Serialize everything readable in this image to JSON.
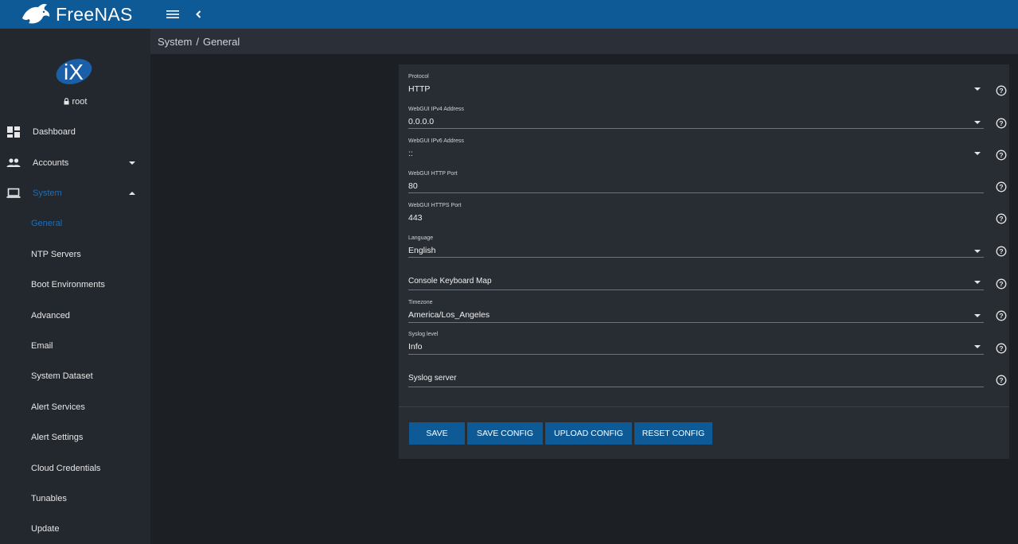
{
  "app": {
    "brand": "FreeNAS",
    "tm": "™"
  },
  "header": {
    "menu_icon": "hamburger-icon",
    "back_icon": "chevron-left-icon"
  },
  "sidebar": {
    "user": "root",
    "items": [
      {
        "label": "Dashboard",
        "icon": "dashboard-icon"
      },
      {
        "label": "Accounts",
        "icon": "people-icon"
      },
      {
        "label": "System",
        "icon": "laptop-icon"
      }
    ],
    "sub_items": [
      {
        "label": "General"
      },
      {
        "label": "NTP Servers"
      },
      {
        "label": "Boot Environments"
      },
      {
        "label": "Advanced"
      },
      {
        "label": "Email"
      },
      {
        "label": "System Dataset"
      },
      {
        "label": "Alert Services"
      },
      {
        "label": "Alert Settings"
      },
      {
        "label": "Cloud Credentials"
      },
      {
        "label": "Tunables"
      },
      {
        "label": "Update"
      }
    ]
  },
  "breadcrumb": {
    "parent": "System",
    "separator": "/",
    "current": "General"
  },
  "form": {
    "fields": [
      {
        "label": "Protocol",
        "value": "HTTP"
      },
      {
        "label": "WebGUI IPv4 Address",
        "value": "0.0.0.0"
      },
      {
        "label": "WebGUI IPv6 Address",
        "value": "::"
      },
      {
        "label": "WebGUI HTTP Port",
        "value": "80"
      },
      {
        "label": "WebGUI HTTPS Port",
        "value": "443"
      },
      {
        "label": "Language",
        "value": "English"
      },
      {
        "label": "Console Keyboard Map",
        "value": ""
      },
      {
        "label": "Timezone",
        "value": "America/Los_Angeles"
      },
      {
        "label": "Syslog level",
        "value": "Info"
      },
      {
        "label": "Syslog server",
        "value": ""
      }
    ]
  },
  "buttons": {
    "save": "SAVE",
    "save_config": "SAVE CONFIG",
    "upload_config": "UPLOAD CONFIG",
    "reset_config": "RESET CONFIG"
  },
  "colors": {
    "topbar": "#0e5a96",
    "accent": "#1f6fb5"
  }
}
